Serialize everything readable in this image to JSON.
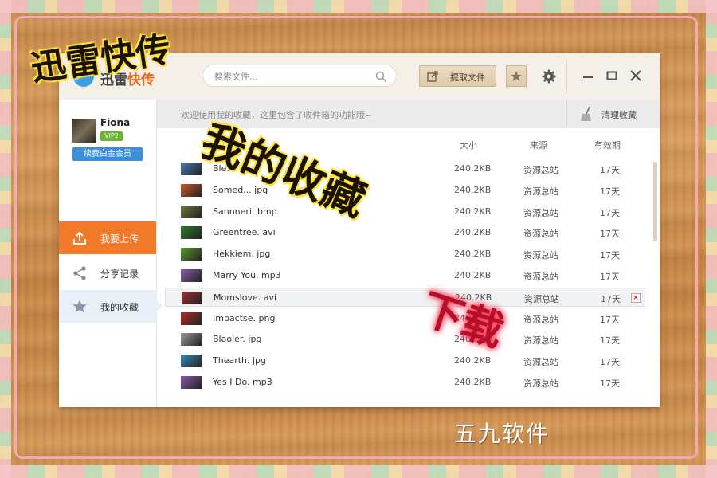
{
  "app": {
    "logo_prefix": "迅雷",
    "logo_accent": "快传"
  },
  "search": {
    "placeholder": "搜索文件..."
  },
  "toolbar": {
    "extract_label": "提取文件"
  },
  "user": {
    "name": "Fiona",
    "vip": "VIP2",
    "renew_label": "续费白金会员"
  },
  "sidebar": {
    "items": [
      {
        "label": "我要上传"
      },
      {
        "label": "分享记录"
      },
      {
        "label": "我的收藏"
      }
    ]
  },
  "notice": {
    "text": "欢迎使用我的收藏，这里包含了收件箱的功能哦~",
    "clear_label": "清理收藏"
  },
  "table": {
    "headers": {
      "size": "大小",
      "source": "来源",
      "expiry": "有效期"
    },
    "rows": [
      {
        "name": "Ble...",
        "size": "240.2KB",
        "source": "资源总站",
        "expiry": "17天",
        "thumb": "#4a7ab0"
      },
      {
        "name": "Somed... jpg",
        "size": "240.2KB",
        "source": "资源总站",
        "expiry": "17天",
        "thumb": "#c85a2a"
      },
      {
        "name": "Sannneri. bmp",
        "size": "240.2KB",
        "source": "资源总站",
        "expiry": "17天",
        "thumb": "#6a7a3a"
      },
      {
        "name": "Greentree. avi",
        "size": "240.2KB",
        "source": "资源总站",
        "expiry": "17天",
        "thumb": "#2f7a2a"
      },
      {
        "name": "Hekkiem. jpg",
        "size": "240.2KB",
        "source": "资源总站",
        "expiry": "17天",
        "thumb": "#5a9a2a"
      },
      {
        "name": "Marry You. mp3",
        "size": "240.2KB",
        "source": "资源总站",
        "expiry": "17天",
        "thumb": "#8a5aa8"
      },
      {
        "name": "Momslove. avi",
        "size": "240.2KB",
        "source": "资源总站",
        "expiry": "17天",
        "thumb": "#9a3030"
      },
      {
        "name": "Impactse. png",
        "size": "240.2KB",
        "source": "资源总站",
        "expiry": "17天",
        "thumb": "#b02a2a"
      },
      {
        "name": "Blaoler. jpg",
        "size": "240.2KB",
        "source": "资源总站",
        "expiry": "17天",
        "thumb": "#9a9a9a"
      },
      {
        "name": "Thearth. jpg",
        "size": "240.2KB",
        "source": "资源总站",
        "expiry": "17天",
        "thumb": "#3a8ac0"
      },
      {
        "name": "Yes I Do. mp3",
        "size": "240.2KB",
        "source": "资源总站",
        "expiry": "17天",
        "thumb": "#8a5aa8"
      }
    ],
    "selected_index": 6,
    "delete_glyph": "×"
  },
  "overlay": {
    "line1": "迅雷快传",
    "line2": "我的收藏",
    "line3": "下载",
    "line4": "五九软件"
  },
  "colors": {
    "accent_orange": "#f07a2a",
    "vip_green": "#6ab42f",
    "renew_blue": "#3a8fd8"
  }
}
